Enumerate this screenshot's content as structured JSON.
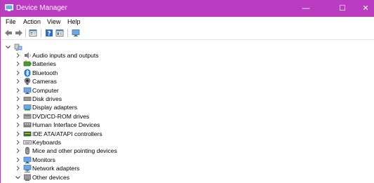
{
  "window": {
    "title": "Device Manager",
    "controls": {
      "minimize": "—",
      "maximize": "☐",
      "close": "✕"
    }
  },
  "menu": [
    "File",
    "Action",
    "View",
    "Help"
  ],
  "toolbar": [
    "back-icon",
    "forward-icon",
    "properties-icon",
    "help-icon",
    "view-icon",
    "monitor-icon"
  ],
  "tree": {
    "root": {
      "expanded": true,
      "icon": "computer-root-icon"
    },
    "categories": [
      {
        "label": "Audio inputs and outputs",
        "icon": "speaker-icon",
        "expanded": false
      },
      {
        "label": "Batteries",
        "icon": "battery-icon",
        "expanded": false
      },
      {
        "label": "Bluetooth",
        "icon": "bluetooth-icon",
        "expanded": false
      },
      {
        "label": "Cameras",
        "icon": "camera-icon",
        "expanded": false
      },
      {
        "label": "Computer",
        "icon": "computer-icon",
        "expanded": false
      },
      {
        "label": "Disk drives",
        "icon": "disk-icon",
        "expanded": false
      },
      {
        "label": "Display adapters",
        "icon": "display-adapter-icon",
        "expanded": false
      },
      {
        "label": "DVD/CD-ROM drives",
        "icon": "dvd-icon",
        "expanded": false
      },
      {
        "label": "Human Interface Devices",
        "icon": "hid-icon",
        "expanded": false
      },
      {
        "label": "IDE ATA/ATAPI controllers",
        "icon": "ide-icon",
        "expanded": false
      },
      {
        "label": "Keyboards",
        "icon": "keyboard-icon",
        "expanded": false
      },
      {
        "label": "Mice and other pointing devices",
        "icon": "mouse-icon",
        "expanded": false
      },
      {
        "label": "Monitors",
        "icon": "monitor-icon",
        "expanded": false
      },
      {
        "label": "Network adapters",
        "icon": "network-icon",
        "expanded": false
      },
      {
        "label": "Other devices",
        "icon": "other-devices-icon",
        "expanded": true
      }
    ]
  },
  "colors": {
    "titlebar": "#b93cc1",
    "accent_blue": "#1e78d7"
  }
}
